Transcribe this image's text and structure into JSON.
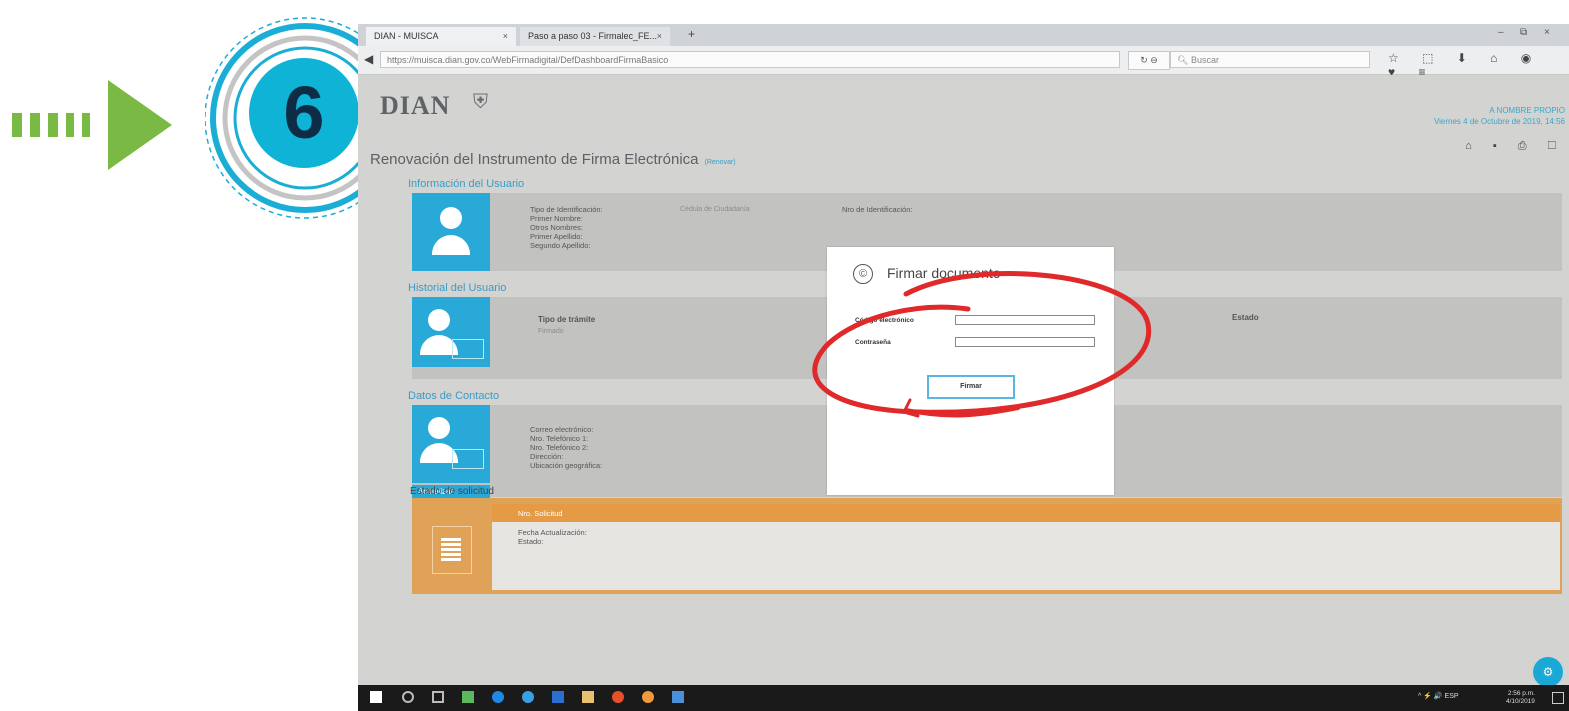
{
  "guide": {
    "step_number": "6",
    "arrow_color": "#7ab943",
    "badge_color": "#0fb3d6"
  },
  "browser": {
    "tabs": [
      {
        "label": "DIAN - MUISCA"
      },
      {
        "label": "Paso a paso 03 - Firmalec_FE..."
      }
    ],
    "tab_close": "×",
    "new_tab": "+",
    "window_controls": [
      "–",
      "⧉",
      "×"
    ],
    "url": "https://muisca.dian.gov.co/WebFirmadigital/DefDashboardFirmaBasico",
    "reload": "↻ ⊖",
    "search_placeholder": "Buscar",
    "toolbar_icons": "☆ ⬚ ⬇ ⌂ ◉ ♥ ≡"
  },
  "header": {
    "logo": "DIAN",
    "logo_crest": "⛨",
    "user_name": "A NOMBRE PROPIO",
    "user_id": "",
    "date": "Viernes 4 de Octubre de 2019, 14:56",
    "icons": "⌂ ▪ ⎙ ☐"
  },
  "page_title": "Renovación del Instrumento de Firma Electrónica",
  "page_title_tag": "(Renovar)",
  "usuario": {
    "section_label": "Información del Usuario",
    "fields": [
      "Tipo de Identificación:",
      "Primer Nombre:",
      "Otros Nombres:",
      "Primer Apellido:",
      "Segundo Apellido:"
    ],
    "values": [
      "Cédula de Ciudadanía",
      "",
      "",
      "",
      ""
    ],
    "extra_label": "Nro de Identificación:",
    "extra_value": ""
  },
  "historial": {
    "section_label": "Historial del Usuario",
    "col_tipo": "Tipo de trámite",
    "col_tipo_value": "Firmado",
    "col_estado": "Estado",
    "col_estado_value": "",
    "note": ""
  },
  "contacto": {
    "section_label": "Datos de Contacto",
    "fields": [
      "Correo electrónico:",
      "Nro. Telefónico 1:",
      "Nro. Telefónico 2:",
      "Dirección:",
      "Ubicación geográfica:"
    ],
    "values": [
      "",
      "",
      "",
      "",
      ""
    ],
    "update_button": "Actualizar"
  },
  "solicitud": {
    "section_label": "Estado de solicitud",
    "row1_label": "Nro. Solicitud",
    "row1_value": "",
    "fields": [
      "Fecha Actualización:",
      "Estado:"
    ],
    "values": [
      "",
      ""
    ]
  },
  "modal": {
    "icon": "©",
    "title": "Firmar documento",
    "subtitle": "",
    "code_label": "Código electrónico",
    "code_link": "",
    "password_label": "Contraseña",
    "password_link": "",
    "submit_label": "Firmar"
  },
  "fab_icon": "⚙",
  "footer": {
    "text": ""
  },
  "taskbar": {
    "tray": "^ ⚡ 🔊 ESP",
    "time": "2:56 p.m.",
    "date": "4/10/2019"
  },
  "annotation_color": "#e0292a"
}
